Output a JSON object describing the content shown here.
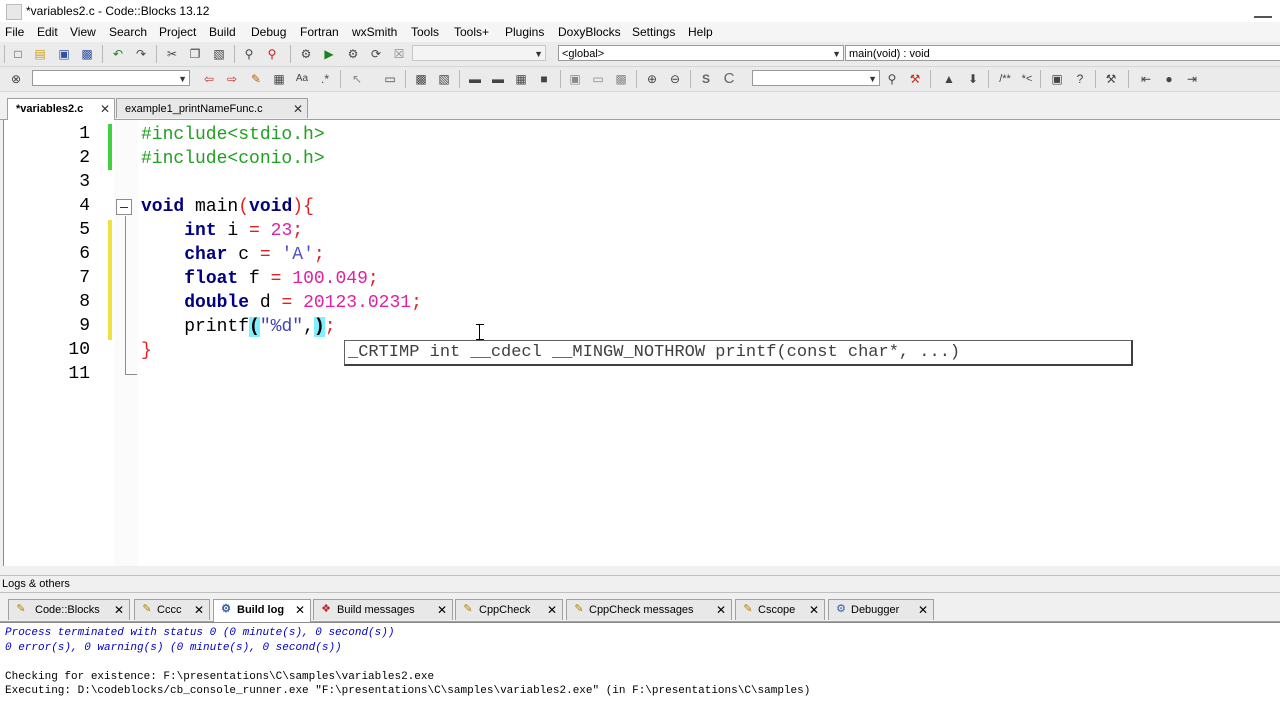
{
  "window": {
    "title": "*variables2.c - Code::Blocks 13.12"
  },
  "menu": [
    "File",
    "Edit",
    "View",
    "Search",
    "Project",
    "Build",
    "Debug",
    "Fortran",
    "wxSmith",
    "Tools",
    "Tools+",
    "Plugins",
    "DoxyBlocks",
    "Settings",
    "Help"
  ],
  "toolbar1": {
    "scope": "<global>",
    "function": "main(void) : void"
  },
  "editor_tabs": [
    {
      "label": "*variables2.c",
      "active": true
    },
    {
      "label": "example1_printNameFunc.c",
      "active": false
    }
  ],
  "code": {
    "line_numbers": [
      "1",
      "2",
      "3",
      "4",
      "5",
      "6",
      "7",
      "8",
      "9",
      "10",
      "11"
    ],
    "calltip": "_CRTIMP int __cdecl __MINGW_NOTHROW printf(const char*, ...)"
  },
  "logs": {
    "title": "Logs & others",
    "tabs": [
      {
        "label": "Code::Blocks",
        "icon": "codeblocks-icon"
      },
      {
        "label": "Cccc",
        "icon": "pencil-icon"
      },
      {
        "label": "Build log",
        "icon": "gear-icon",
        "active": true
      },
      {
        "label": "Build messages",
        "icon": "pin-icon"
      },
      {
        "label": "CppCheck",
        "icon": "pencil-icon"
      },
      {
        "label": "CppCheck messages",
        "icon": "pencil-icon"
      },
      {
        "label": "Cscope",
        "icon": "pencil-icon"
      },
      {
        "label": "Debugger",
        "icon": "gear-icon"
      }
    ],
    "lines": [
      "Process terminated with status 0 (0 minute(s), 0 second(s))",
      "0 error(s), 0 warning(s) (0 minute(s), 0 second(s))",
      "",
      "Checking for existence: F:\\presentations\\C\\samples\\variables2.exe",
      "Executing: D:\\codeblocks/cb_console_runner.exe \"F:\\presentations\\C\\samples\\variables2.exe\" (in F:\\presentations\\C\\samples)"
    ]
  }
}
